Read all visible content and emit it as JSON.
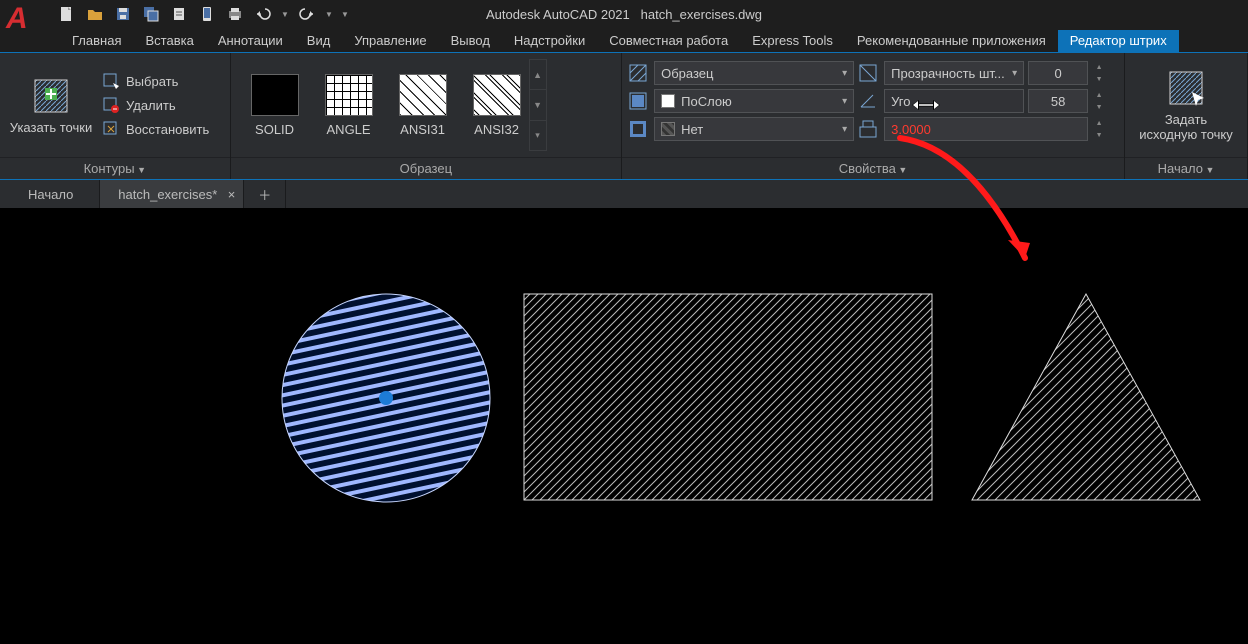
{
  "app": {
    "title": "Autodesk AutoCAD 2021",
    "file": "hatch_exercises.dwg"
  },
  "tabs": {
    "items": [
      "Главная",
      "Вставка",
      "Аннотации",
      "Вид",
      "Управление",
      "Вывод",
      "Надстройки",
      "Совместная работа",
      "Express Tools",
      "Рекомендованные приложения",
      "Редактор штрих"
    ],
    "active_index": 10
  },
  "ribbon": {
    "panel_boundaries": {
      "pick_points": "Указать точки",
      "select": "Выбрать",
      "remove": "Удалить",
      "recreate": "Восстановить",
      "boundaries_title": "Контуры"
    },
    "panel_pattern": {
      "title": "Образец",
      "patterns": [
        {
          "name": "SOLID",
          "style": "solid"
        },
        {
          "name": "ANGLE",
          "style": "angle"
        },
        {
          "name": "ANSI31",
          "style": "ansi31"
        },
        {
          "name": "ANSI32",
          "style": "ansi32"
        }
      ]
    },
    "panel_props": {
      "title": "Свойства",
      "pattern_mode": "Образец",
      "transparency_label": "Прозрачность шт...",
      "transparency_value": "0",
      "color_label": "ПоСлою",
      "angle_label": "Уго",
      "angle_value": "58",
      "bgcolor_label": "Нет",
      "scale_value": "3.0000"
    },
    "panel_origin": {
      "btn1": "Задать",
      "btn2": "исходную точку",
      "title": "Начало"
    }
  },
  "filetabs": {
    "home": "Начало",
    "file1": "hatch_exercises*"
  }
}
